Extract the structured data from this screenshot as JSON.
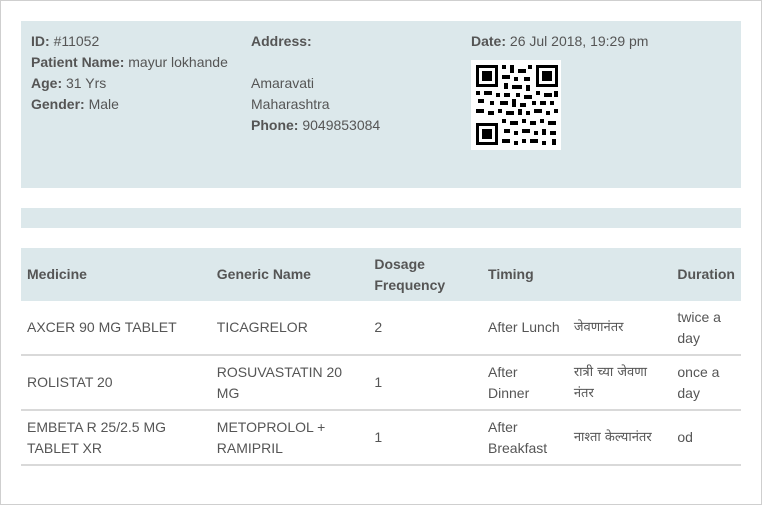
{
  "patient": {
    "id_label": "ID:",
    "id_value": "#11052",
    "name_label": "Patient Name:",
    "name_value": "mayur lokhande",
    "age_label": "Age:",
    "age_value": "31 Yrs",
    "gender_label": "Gender:",
    "gender_value": "Male"
  },
  "address": {
    "label": "Address:",
    "line1": "",
    "city": "Amaravati",
    "state": "Maharashtra",
    "phone_label": "Phone:",
    "phone_value": "9049853084"
  },
  "visit": {
    "date_label": "Date:",
    "date_value": "26 Jul 2018, 19:29 pm",
    "qr_icon": "qr-code-icon"
  },
  "prescription": {
    "headers": {
      "medicine": "Medicine",
      "generic": "Generic Name",
      "dosage": "Dosage Frequency",
      "timing": "Timing",
      "duration": "Duration"
    },
    "rows": [
      {
        "medicine": "AXCER 90 MG TABLET",
        "generic": "TICAGRELOR",
        "dosage": "2",
        "timing": "After Lunch",
        "timing_local": "जेवणानंतर",
        "duration": "twice a day"
      },
      {
        "medicine": "ROLISTAT 20",
        "generic": "ROSUVASTATIN 20 MG",
        "dosage": "1",
        "timing": "After Dinner",
        "timing_local": "रात्री च्या जेवणा नंतर",
        "duration": "once a day"
      },
      {
        "medicine": "EMBETA R 25/2.5 MG TABLET XR",
        "generic": "METOPROLOL + RAMIPRIL",
        "dosage": "1",
        "timing": "After Breakfast",
        "timing_local": "नाश्ता केल्यानंतर",
        "duration": "od"
      }
    ]
  },
  "colors": {
    "panel_bg": "#dce8eb",
    "text": "#555555",
    "divider": "#d9d9d9"
  }
}
